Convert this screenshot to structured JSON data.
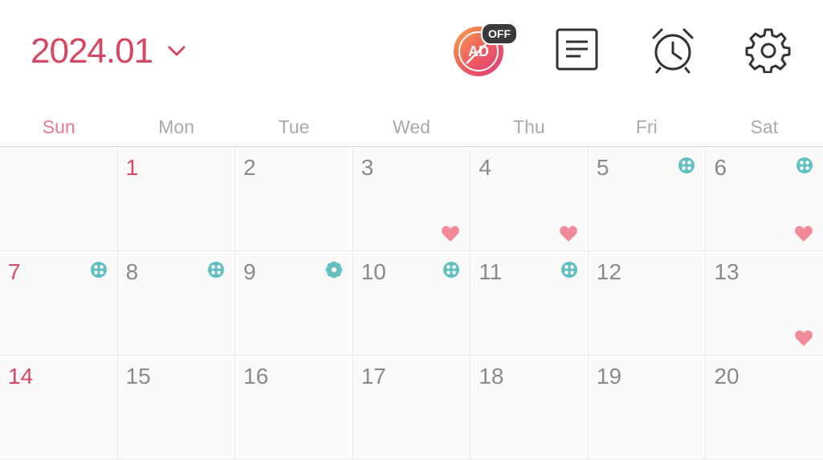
{
  "header": {
    "month_label": "2024.01",
    "ad_label": "AD",
    "off_badge": "OFF"
  },
  "weekdays": [
    "Sun",
    "Mon",
    "Tue",
    "Wed",
    "Thu",
    "Fri",
    "Sat"
  ],
  "colors": {
    "accent": "#d44864",
    "teal": "#63c0c0",
    "heart": "#f38a9a",
    "muted": "#8a8a8a"
  },
  "weeks": [
    [
      {
        "day": "",
        "red": false,
        "icon": null,
        "heart": false
      },
      {
        "day": "1",
        "red": true,
        "icon": null,
        "heart": false
      },
      {
        "day": "2",
        "red": false,
        "icon": null,
        "heart": false
      },
      {
        "day": "3",
        "red": false,
        "icon": null,
        "heart": true
      },
      {
        "day": "4",
        "red": false,
        "icon": null,
        "heart": true
      },
      {
        "day": "5",
        "red": false,
        "icon": "ovulation-icon",
        "heart": false
      },
      {
        "day": "6",
        "red": false,
        "icon": "ovulation-icon",
        "heart": true
      }
    ],
    [
      {
        "day": "7",
        "red": true,
        "icon": "ovulation-icon",
        "heart": false
      },
      {
        "day": "8",
        "red": false,
        "icon": "ovulation-icon",
        "heart": false
      },
      {
        "day": "9",
        "red": false,
        "icon": "flower-icon",
        "heart": false
      },
      {
        "day": "10",
        "red": false,
        "icon": "ovulation-icon",
        "heart": false
      },
      {
        "day": "11",
        "red": false,
        "icon": "ovulation-icon",
        "heart": false
      },
      {
        "day": "12",
        "red": false,
        "icon": null,
        "heart": false
      },
      {
        "day": "13",
        "red": false,
        "icon": null,
        "heart": true
      }
    ],
    [
      {
        "day": "14",
        "red": true,
        "icon": null,
        "heart": false
      },
      {
        "day": "15",
        "red": false,
        "icon": null,
        "heart": false
      },
      {
        "day": "16",
        "red": false,
        "icon": null,
        "heart": false
      },
      {
        "day": "17",
        "red": false,
        "icon": null,
        "heart": false
      },
      {
        "day": "18",
        "red": false,
        "icon": null,
        "heart": false
      },
      {
        "day": "19",
        "red": false,
        "icon": null,
        "heart": false
      },
      {
        "day": "20",
        "red": false,
        "icon": null,
        "heart": false
      }
    ]
  ]
}
